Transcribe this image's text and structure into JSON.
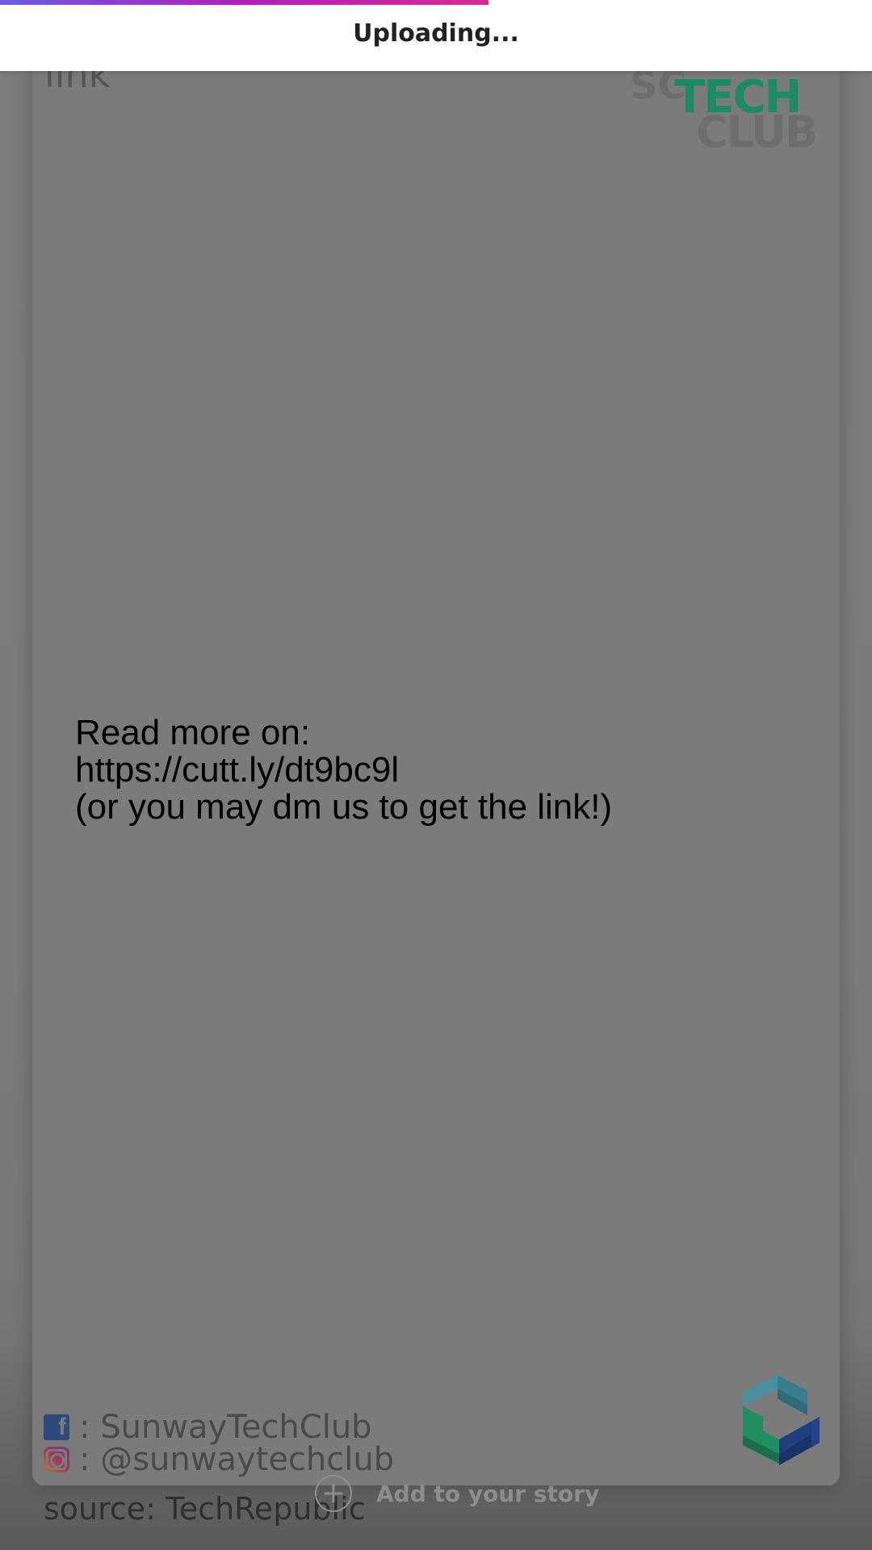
{
  "upload": {
    "status_text": "Uploading...",
    "progress": 0.56
  },
  "story": {
    "top_text": "link",
    "logo": {
      "sc": "SC",
      "tech": "TECH",
      "club": "CLUB"
    },
    "read_more_lines": [
      "Read more on:",
      "https://cutt.ly/dt9bc9l",
      "(or you may dm us to get the link!)"
    ],
    "social": {
      "facebook": ": SunwayTechClub",
      "instagram": ": @sunwaytechclub"
    },
    "source": "source: TechRepublic"
  },
  "add_story": {
    "label": "Add to your story"
  },
  "icons": {
    "facebook": "facebook-icon",
    "instagram": "instagram-icon",
    "plus": "plus-circle-icon"
  },
  "colors": {
    "overlay": "#7b7b7b",
    "tech_green": "#1c8c67",
    "progress_start": "#6c5ce7",
    "progress_end": "#d92a8f"
  }
}
